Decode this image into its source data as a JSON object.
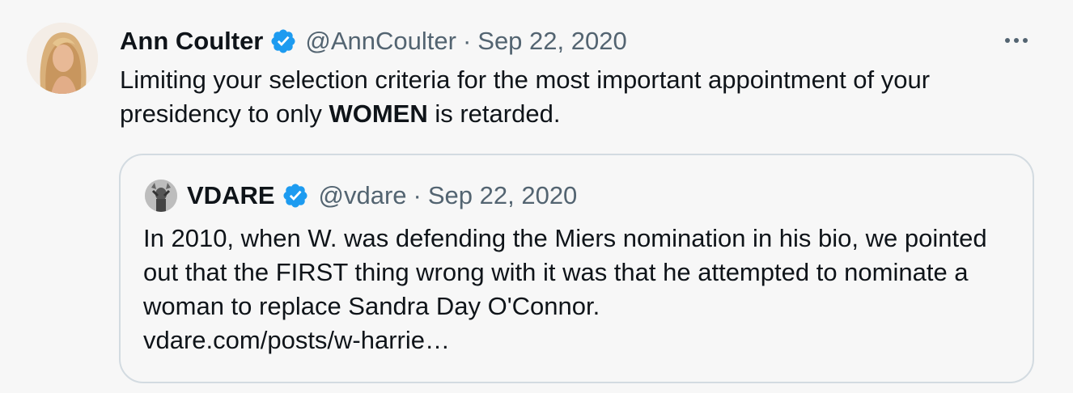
{
  "tweet": {
    "author_name": "Ann Coulter",
    "handle": "@AnnCoulter",
    "separator": "·",
    "date": "Sep 22, 2020",
    "text_before": "Limiting your selection criteria for the most important appointment of your presidency to only ",
    "text_bold": "WOMEN",
    "text_after": " is retarded.",
    "more_icon": "more-icon",
    "verified_icon": "verified-badge-icon"
  },
  "quoted": {
    "author_name": "VDARE",
    "handle": "@vdare",
    "separator": "·",
    "date": "Sep 22, 2020",
    "text": "In 2010, when W. was defending the Miers nomination in his bio, we pointed out that the FIRST  thing wrong with it was that he attempted to nominate a woman to replace Sandra Day O'Connor.",
    "link": "vdare.com/posts/w-harrie…",
    "verified_icon": "verified-badge-icon"
  },
  "colors": {
    "background": "#f7f7f7",
    "text": "#0f1419",
    "secondary_text": "#536471",
    "verified_blue": "#1d9bf0",
    "quote_border": "#d3dbe1"
  }
}
